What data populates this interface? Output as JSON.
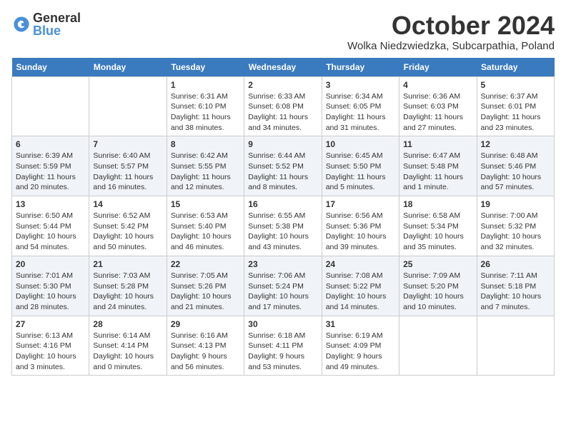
{
  "logo": {
    "general": "General",
    "blue": "Blue"
  },
  "title": "October 2024",
  "location": "Wolka Niedzwiedzka, Subcarpathia, Poland",
  "headers": [
    "Sunday",
    "Monday",
    "Tuesday",
    "Wednesday",
    "Thursday",
    "Friday",
    "Saturday"
  ],
  "weeks": [
    [
      {
        "day": "",
        "info": ""
      },
      {
        "day": "",
        "info": ""
      },
      {
        "day": "1",
        "info": "Sunrise: 6:31 AM\nSunset: 6:10 PM\nDaylight: 11 hours and 38 minutes."
      },
      {
        "day": "2",
        "info": "Sunrise: 6:33 AM\nSunset: 6:08 PM\nDaylight: 11 hours and 34 minutes."
      },
      {
        "day": "3",
        "info": "Sunrise: 6:34 AM\nSunset: 6:05 PM\nDaylight: 11 hours and 31 minutes."
      },
      {
        "day": "4",
        "info": "Sunrise: 6:36 AM\nSunset: 6:03 PM\nDaylight: 11 hours and 27 minutes."
      },
      {
        "day": "5",
        "info": "Sunrise: 6:37 AM\nSunset: 6:01 PM\nDaylight: 11 hours and 23 minutes."
      }
    ],
    [
      {
        "day": "6",
        "info": "Sunrise: 6:39 AM\nSunset: 5:59 PM\nDaylight: 11 hours and 20 minutes."
      },
      {
        "day": "7",
        "info": "Sunrise: 6:40 AM\nSunset: 5:57 PM\nDaylight: 11 hours and 16 minutes."
      },
      {
        "day": "8",
        "info": "Sunrise: 6:42 AM\nSunset: 5:55 PM\nDaylight: 11 hours and 12 minutes."
      },
      {
        "day": "9",
        "info": "Sunrise: 6:44 AM\nSunset: 5:52 PM\nDaylight: 11 hours and 8 minutes."
      },
      {
        "day": "10",
        "info": "Sunrise: 6:45 AM\nSunset: 5:50 PM\nDaylight: 11 hours and 5 minutes."
      },
      {
        "day": "11",
        "info": "Sunrise: 6:47 AM\nSunset: 5:48 PM\nDaylight: 11 hours and 1 minute."
      },
      {
        "day": "12",
        "info": "Sunrise: 6:48 AM\nSunset: 5:46 PM\nDaylight: 10 hours and 57 minutes."
      }
    ],
    [
      {
        "day": "13",
        "info": "Sunrise: 6:50 AM\nSunset: 5:44 PM\nDaylight: 10 hours and 54 minutes."
      },
      {
        "day": "14",
        "info": "Sunrise: 6:52 AM\nSunset: 5:42 PM\nDaylight: 10 hours and 50 minutes."
      },
      {
        "day": "15",
        "info": "Sunrise: 6:53 AM\nSunset: 5:40 PM\nDaylight: 10 hours and 46 minutes."
      },
      {
        "day": "16",
        "info": "Sunrise: 6:55 AM\nSunset: 5:38 PM\nDaylight: 10 hours and 43 minutes."
      },
      {
        "day": "17",
        "info": "Sunrise: 6:56 AM\nSunset: 5:36 PM\nDaylight: 10 hours and 39 minutes."
      },
      {
        "day": "18",
        "info": "Sunrise: 6:58 AM\nSunset: 5:34 PM\nDaylight: 10 hours and 35 minutes."
      },
      {
        "day": "19",
        "info": "Sunrise: 7:00 AM\nSunset: 5:32 PM\nDaylight: 10 hours and 32 minutes."
      }
    ],
    [
      {
        "day": "20",
        "info": "Sunrise: 7:01 AM\nSunset: 5:30 PM\nDaylight: 10 hours and 28 minutes."
      },
      {
        "day": "21",
        "info": "Sunrise: 7:03 AM\nSunset: 5:28 PM\nDaylight: 10 hours and 24 minutes."
      },
      {
        "day": "22",
        "info": "Sunrise: 7:05 AM\nSunset: 5:26 PM\nDaylight: 10 hours and 21 minutes."
      },
      {
        "day": "23",
        "info": "Sunrise: 7:06 AM\nSunset: 5:24 PM\nDaylight: 10 hours and 17 minutes."
      },
      {
        "day": "24",
        "info": "Sunrise: 7:08 AM\nSunset: 5:22 PM\nDaylight: 10 hours and 14 minutes."
      },
      {
        "day": "25",
        "info": "Sunrise: 7:09 AM\nSunset: 5:20 PM\nDaylight: 10 hours and 10 minutes."
      },
      {
        "day": "26",
        "info": "Sunrise: 7:11 AM\nSunset: 5:18 PM\nDaylight: 10 hours and 7 minutes."
      }
    ],
    [
      {
        "day": "27",
        "info": "Sunrise: 6:13 AM\nSunset: 4:16 PM\nDaylight: 10 hours and 3 minutes."
      },
      {
        "day": "28",
        "info": "Sunrise: 6:14 AM\nSunset: 4:14 PM\nDaylight: 10 hours and 0 minutes."
      },
      {
        "day": "29",
        "info": "Sunrise: 6:16 AM\nSunset: 4:13 PM\nDaylight: 9 hours and 56 minutes."
      },
      {
        "day": "30",
        "info": "Sunrise: 6:18 AM\nSunset: 4:11 PM\nDaylight: 9 hours and 53 minutes."
      },
      {
        "day": "31",
        "info": "Sunrise: 6:19 AM\nSunset: 4:09 PM\nDaylight: 9 hours and 49 minutes."
      },
      {
        "day": "",
        "info": ""
      },
      {
        "day": "",
        "info": ""
      }
    ]
  ]
}
